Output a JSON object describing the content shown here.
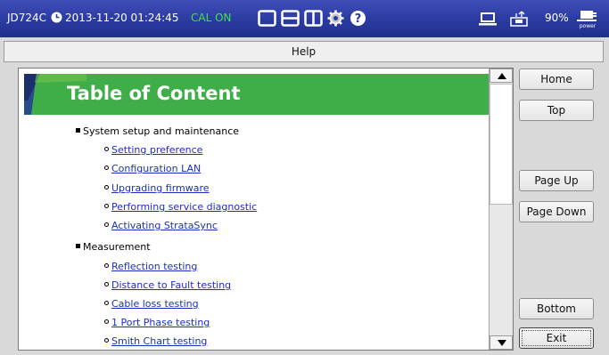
{
  "statusbar": {
    "device": "JD724C",
    "datetime": "2013-11-20 01:24:45",
    "cal_status": "CAL ON",
    "layout_icons": [
      "single-panel-icon",
      "dual-horizontal-icon",
      "dual-vertical-icon",
      "settings-gear-icon",
      "help-icon"
    ],
    "battery_percent": "90%",
    "power_label": "power"
  },
  "header": {
    "title": "Help"
  },
  "content": {
    "heading": "Table of Content",
    "sections": [
      {
        "title": "System setup and maintenance",
        "items": [
          "Setting preference",
          "Configuration LAN",
          "Upgrading firmware",
          "Performing service diagnostic",
          "Activating StrataSync"
        ]
      },
      {
        "title": "Measurement",
        "items": [
          "Reflection testing",
          "Distance to Fault testing",
          "Cable loss testing",
          "1 Port Phase testing",
          "Smith Chart testing"
        ]
      }
    ]
  },
  "buttons": {
    "home": "Home",
    "top": "Top",
    "page_up": "Page Up",
    "page_down": "Page Down",
    "bottom": "Bottom",
    "exit": "Exit"
  },
  "colors": {
    "titlebar": "#2a3aa0",
    "cal_on": "#46e04a",
    "banner": "#3fae49",
    "link": "#1a2fbf"
  }
}
